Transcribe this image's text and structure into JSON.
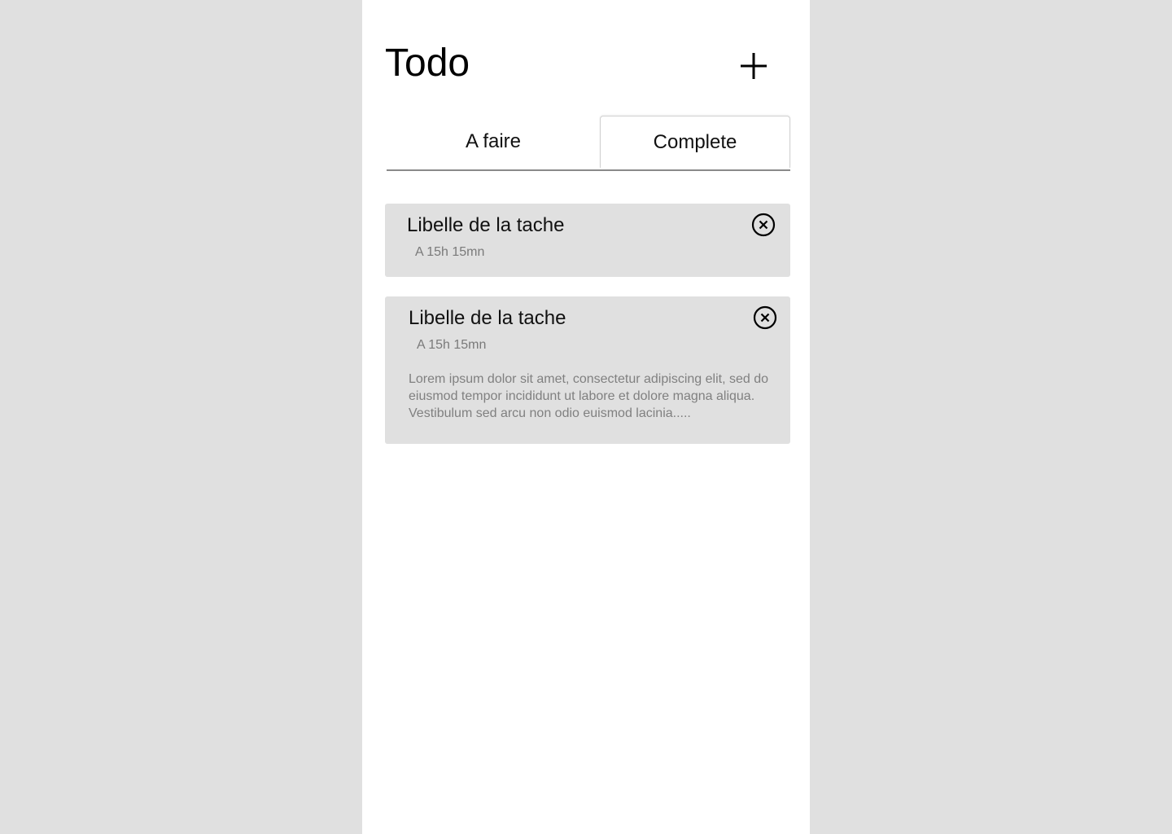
{
  "header": {
    "title": "Todo",
    "add_icon": "plus-icon"
  },
  "tabs": [
    {
      "label": "A faire",
      "active": false
    },
    {
      "label": "Complete",
      "active": true
    }
  ],
  "tasks": [
    {
      "title": "Libelle de la tache",
      "time": "A 15h 15mn",
      "close_icon": "close-circle-icon"
    },
    {
      "title": "Libelle de la tache",
      "time": "A 15h 15mn",
      "description": "Lorem ipsum dolor sit amet, consectetur adipiscing elit, sed do eiusmod tempor incididunt ut labore et dolore magna aliqua. Vestibulum sed arcu non odio euismod lacinia.....",
      "close_icon": "close-circle-icon"
    }
  ],
  "colors": {
    "background": "#e0e0e0",
    "surface": "#ffffff",
    "card": "#e0e0e0",
    "text": "#111111",
    "muted_text": "#7a7a7a",
    "tab_underline": "#8a8a8a"
  }
}
